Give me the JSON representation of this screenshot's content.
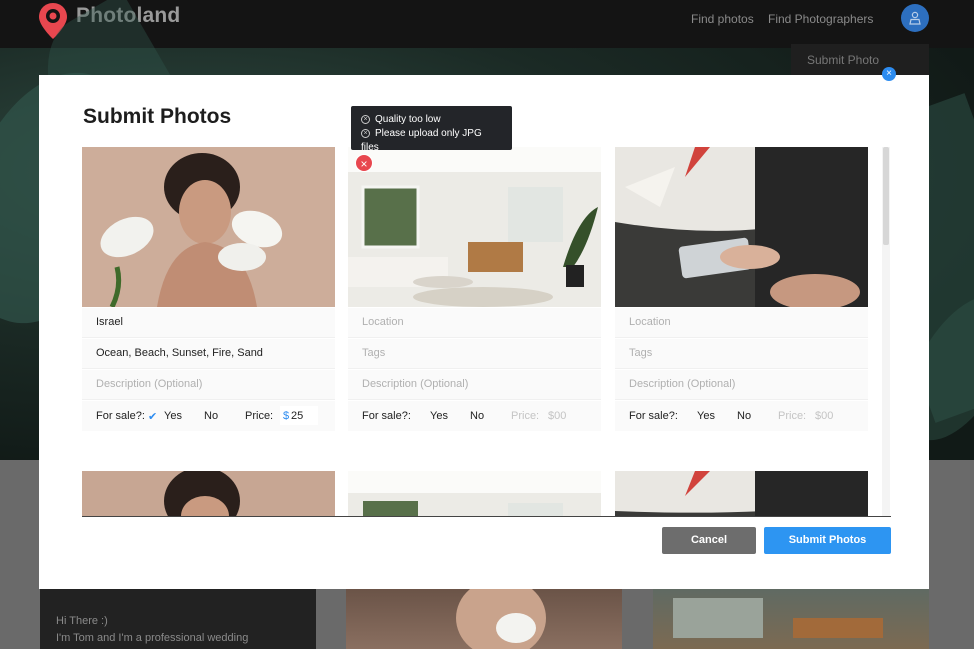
{
  "header": {
    "brand": "Photoland",
    "nav": [
      "Find photos",
      "Find Photographers"
    ],
    "dropdown_item": "Submit Photo",
    "accent_color": "#2d6fbf",
    "logo_color": "#e8474f"
  },
  "background": {
    "greeting": "Hi There :)",
    "intro": "I'm Tom and I'm a professional wedding"
  },
  "modal": {
    "title": "Submit Photos",
    "close_icon": "close-icon",
    "tooltip": {
      "errors": [
        "Quality too low",
        "Please upload only JPG",
        "files"
      ]
    },
    "cards": [
      {
        "image": "portrait-woman-with-lilies",
        "location": "Israel",
        "tags": "Ocean, Beach, Sunset, Fire, Sand",
        "description_placeholder": "Description (Optional)",
        "for_sale_label": "For sale?:",
        "yes": "Yes",
        "no": "No",
        "yes_checked": true,
        "price_label": "Price:",
        "currency": "$",
        "price": "25"
      },
      {
        "image": "modern-living-room",
        "location_placeholder": "Location",
        "tags_placeholder": "Tags",
        "description_placeholder": "Description (Optional)",
        "for_sale_label": "For sale?:",
        "yes": "Yes",
        "no": "No",
        "price_label": "Price:",
        "price_placeholder": "$00",
        "has_error": true
      },
      {
        "image": "surfboard-design-hands",
        "location_placeholder": "Location",
        "tags_placeholder": "Tags",
        "description_placeholder": "Description (Optional)",
        "for_sale_label": "For sale?:",
        "yes": "Yes",
        "no": "No",
        "price_label": "Price:",
        "price_placeholder": "$00"
      }
    ],
    "cancel_label": "Cancel",
    "submit_label": "Submit Photos",
    "submit_color": "#2d95f2",
    "cancel_color": "#6d6d6d"
  }
}
